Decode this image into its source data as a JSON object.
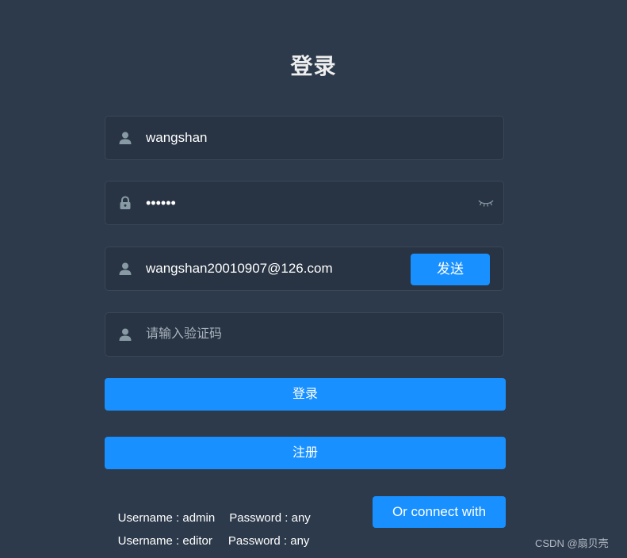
{
  "title": "登录",
  "fields": {
    "username": {
      "value": "wangshan",
      "icon": "user-icon"
    },
    "password": {
      "value": "••••••",
      "icon": "lock-icon",
      "toggle_icon": "eye-closed-icon"
    },
    "email": {
      "value": "wangshan20010907@126.com",
      "icon": "user-icon",
      "send_label": "发送"
    },
    "code": {
      "placeholder": "请输入验证码",
      "icon": "user-icon"
    }
  },
  "buttons": {
    "login": "登录",
    "register": "注册",
    "connect": "Or connect with"
  },
  "tips": [
    {
      "username": "Username : admin",
      "password": "Password : any"
    },
    {
      "username": "Username : editor",
      "password": "Password : any"
    }
  ],
  "watermark": "CSDN @扇贝壳",
  "colors": {
    "background": "#2d3a4b",
    "field_bg": "#283443",
    "primary": "#1890ff",
    "icon": "#889aa4"
  }
}
